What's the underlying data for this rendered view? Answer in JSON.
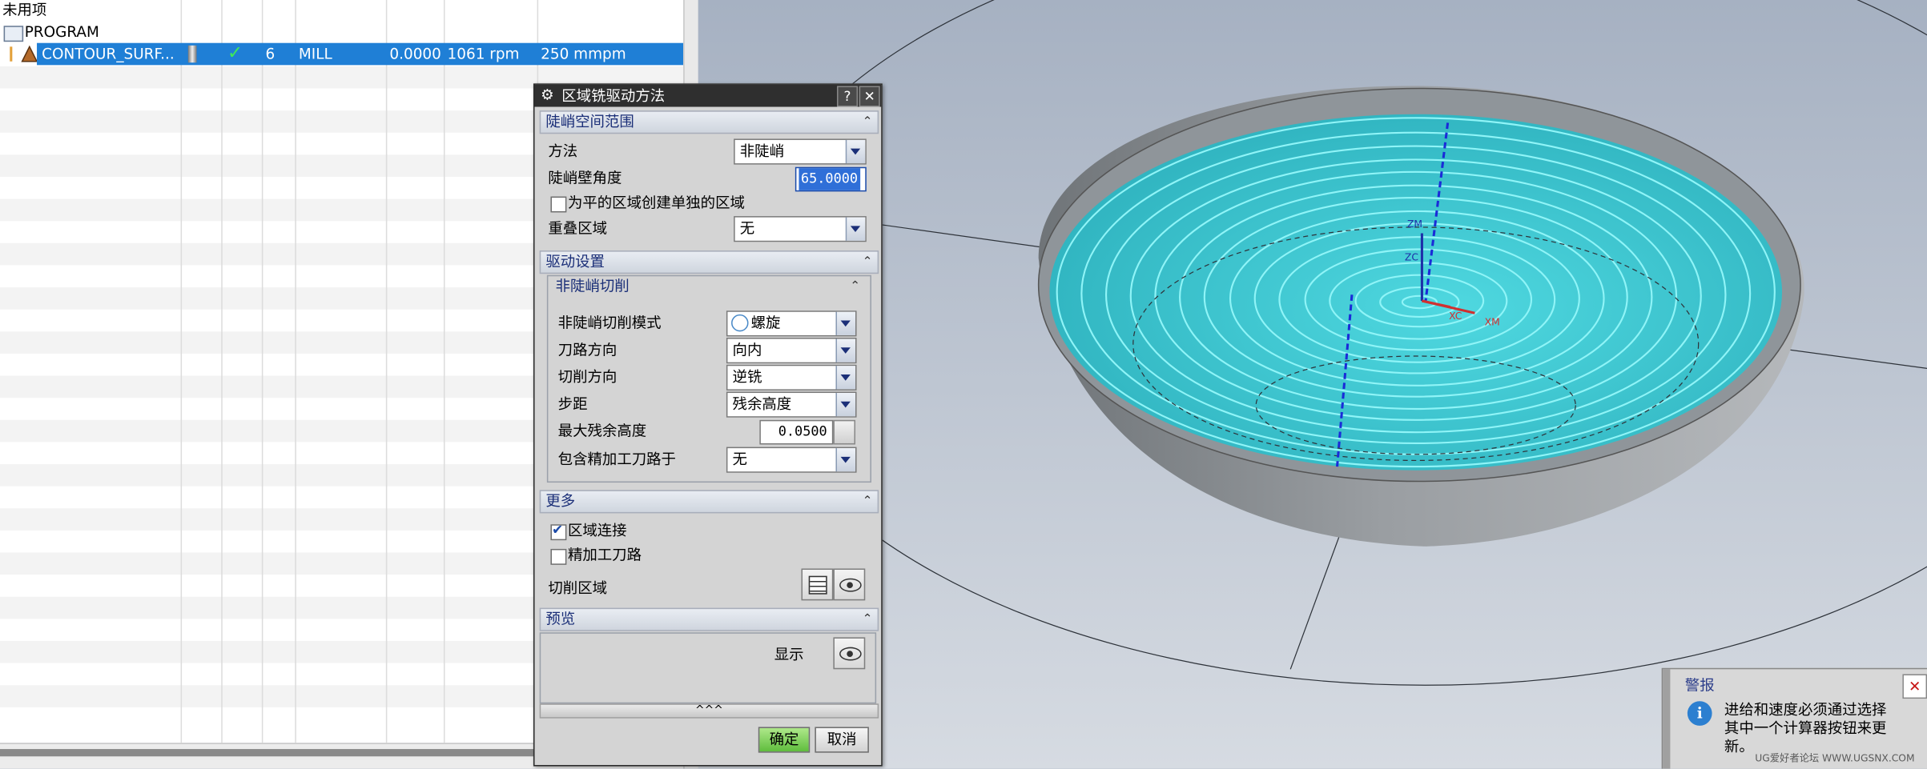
{
  "navigator": {
    "top_item": "未用项",
    "program_item": "PROGRAM",
    "operation": {
      "name": "CONTOUR_SURF...",
      "tool_number": "6",
      "type": "MILL",
      "value": "0.0000",
      "speed": "1061 rpm",
      "feed": "250 mmpm"
    }
  },
  "dialog": {
    "title": "区域铣驱动方法",
    "help_label": "?",
    "close_label": "✕",
    "steep_section": {
      "header": "陡峭空间范围",
      "method_label": "方法",
      "method_value": "非陡峭",
      "angle_label": "陡峭壁角度",
      "angle_value": "65.0000",
      "flat_checkbox_label": "为平的区域创建单独的区域",
      "flat_checked": false,
      "overlap_label": "重叠区域",
      "overlap_value": "无"
    },
    "drive_section": {
      "header": "驱动设置",
      "sub_header": "非陡峭切削",
      "mode_label": "非陡峭切削模式",
      "mode_value": "螺旋",
      "path_dir_label": "刀路方向",
      "path_dir_value": "向内",
      "cut_dir_label": "切削方向",
      "cut_dir_value": "逆铣",
      "stepover_label": "步距",
      "stepover_value": "残余高度",
      "max_scallop_label": "最大残余高度",
      "max_scallop_value": "0.0500",
      "include_finish_label": "包含精加工刀路于",
      "include_finish_value": "无"
    },
    "more_section": {
      "header": "更多",
      "region_connect_label": "区域连接",
      "region_connect_checked": true,
      "finish_path_label": "精加工刀路",
      "finish_path_checked": false,
      "cut_region_label": "切削区域"
    },
    "preview_section": {
      "header": "预览",
      "display_label": "显示"
    },
    "collapse_label": "^^^",
    "ok_label": "确定",
    "cancel_label": "取消"
  },
  "viewport": {
    "axis_labels": {
      "zm": "ZM",
      "zc": "ZC",
      "xc": "XC",
      "xm": "XM"
    },
    "toolpath_color": "#2fe3ee",
    "part_color": "#a6aaae"
  },
  "alert": {
    "title": "警报",
    "message": "进给和速度必须通过选择其中一个计算器按钮来更新。",
    "close_label": "✕"
  },
  "watermark": "UG爱好者论坛 WWW.UGSNX.COM"
}
